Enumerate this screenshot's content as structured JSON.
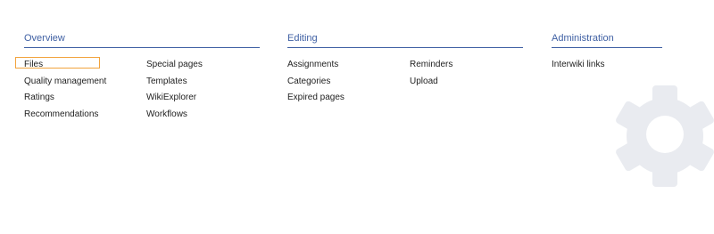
{
  "sections": {
    "overview": {
      "title": "Overview",
      "col1": [
        "Files",
        "Quality management",
        "Ratings",
        "Recommendations"
      ],
      "col2": [
        "Special pages",
        "Templates",
        "WikiExplorer",
        "Workflows"
      ]
    },
    "editing": {
      "title": "Editing",
      "col1": [
        "Assignments",
        "Categories",
        "Expired pages"
      ],
      "col2": [
        "Reminders",
        "Upload"
      ]
    },
    "administration": {
      "title": "Administration",
      "col1": [
        "Interwiki links"
      ]
    }
  },
  "colors": {
    "accent": "#3e5fa3",
    "focus": "#f2a33c",
    "gear": "#e9ebf0",
    "text": "#222222"
  },
  "icons": {
    "background": "gear-icon"
  }
}
